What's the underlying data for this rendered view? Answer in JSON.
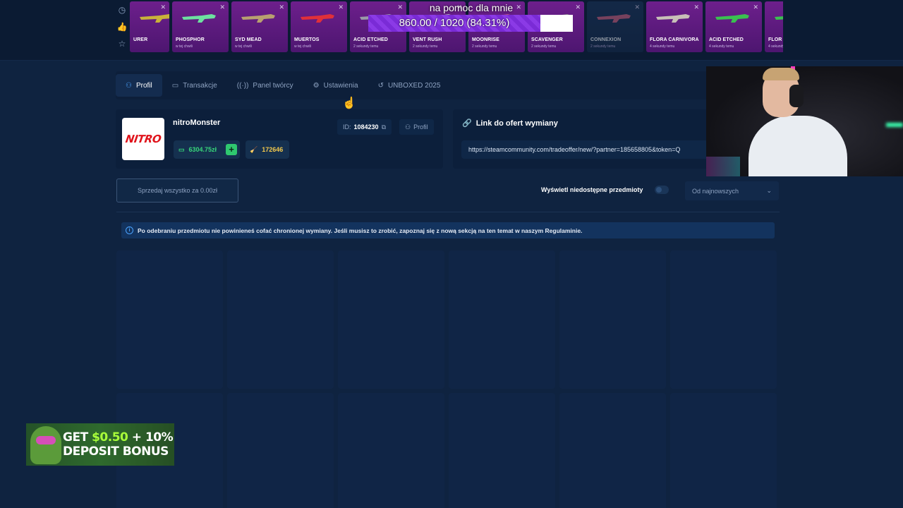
{
  "topbar": {
    "side_icons": [
      {
        "icon": "clock-icon",
        "glyph": "◷"
      },
      {
        "icon": "thumbs-up-icon",
        "glyph": "👍"
      },
      {
        "icon": "star-icon",
        "glyph": "☆"
      }
    ],
    "drops": [
      {
        "name": "URER",
        "sub": "",
        "style": "pink first",
        "color": "#c9b23a"
      },
      {
        "name": "PHOSPHOR",
        "sub": "w tej chwili",
        "style": "pink",
        "color": "#6de0a0"
      },
      {
        "name": "SYD MEAD",
        "sub": "w tej chwili",
        "style": "pink",
        "color": "#b8a070"
      },
      {
        "name": "MUERTOS",
        "sub": "w tej chwili",
        "style": "pink",
        "color": "#e0303a"
      },
      {
        "name": "ACID ETCHED",
        "sub": "2 sekundy temu",
        "style": "pink",
        "color": "#9a9aa8"
      },
      {
        "name": "VENT RUSH",
        "sub": "2 sekundy temu",
        "style": "pink",
        "color": "#b0b0b8"
      },
      {
        "name": "MOONRISE",
        "sub": "2 sekundy temu",
        "style": "pink",
        "color": "#c05080"
      },
      {
        "name": "SCAVENGER",
        "sub": "2 sekundy temu",
        "style": "pink",
        "color": "#8a8a8a"
      },
      {
        "name": "CONNEXION",
        "sub": "2 sekundy temu",
        "style": "blue dim",
        "color": "#d06080"
      },
      {
        "name": "FLORA CARNIVORA",
        "sub": "4 sekundy temu",
        "style": "pink",
        "color": "#c8c0b8"
      },
      {
        "name": "ACID ETCHED",
        "sub": "4 sekundy temu",
        "style": "pink",
        "color": "#3ac050"
      },
      {
        "name": "FLOR",
        "sub": "4 sekundy temu",
        "style": "pink",
        "color": "#3ac050"
      }
    ]
  },
  "donation": {
    "title": "na pomoc dla mnie",
    "progress_text": "860.00 / 1020 (84.31%)",
    "progress_fraction": 0.8431
  },
  "tabs": [
    {
      "label": "Profil",
      "icon": "user-icon",
      "glyph": "⚇",
      "active": true
    },
    {
      "label": "Transakcje",
      "icon": "wallet-icon",
      "glyph": "▭",
      "active": false
    },
    {
      "label": "Panel twórcy",
      "icon": "broadcast-icon",
      "glyph": "((·))",
      "active": false
    },
    {
      "label": "Ustawienia",
      "icon": "gear-icon",
      "glyph": "⚙",
      "active": false
    },
    {
      "label": "UNBOXED 2025",
      "icon": "history-icon",
      "glyph": "↺",
      "active": false
    }
  ],
  "profile": {
    "avatar_text": "NITRO",
    "username": "nitroMonster",
    "balance": "6304.75zł",
    "xp": "172646",
    "id_label": "ID:",
    "id_value": "1084230",
    "profile_button": "Profil"
  },
  "trade": {
    "title": "Link do ofert wymiany",
    "link": "https://steamcommunity.com/tradeoffer/new/?partner=185658805&token=Q"
  },
  "toolbar": {
    "sell_all": "Sprzedaj wszystko za 0.00zł",
    "toggle_label": "Wyświetl niedostępne przedmioty",
    "sort_value": "Od najnowszych"
  },
  "notice": {
    "text": "Po odebraniu przedmiotu nie powinieneś cofać chronionej wymiany. Jeśli musisz to zrobić, zapoznaj się z nową sekcją na ten temat w naszym Regulaminie."
  },
  "ad": {
    "line1_prefix": "GET ",
    "line1_amount": "$0.50",
    "line1_suffix": " + 10%",
    "line2": "DEPOSIT BONUS"
  },
  "colors": {
    "background": "#0f2340",
    "accent": "#4aa3ff",
    "balance_green": "#37d67a",
    "xp_gold": "#f2c94c",
    "drop_pink": "#6d1f8c",
    "donation_purple": "#7a2bd6"
  }
}
